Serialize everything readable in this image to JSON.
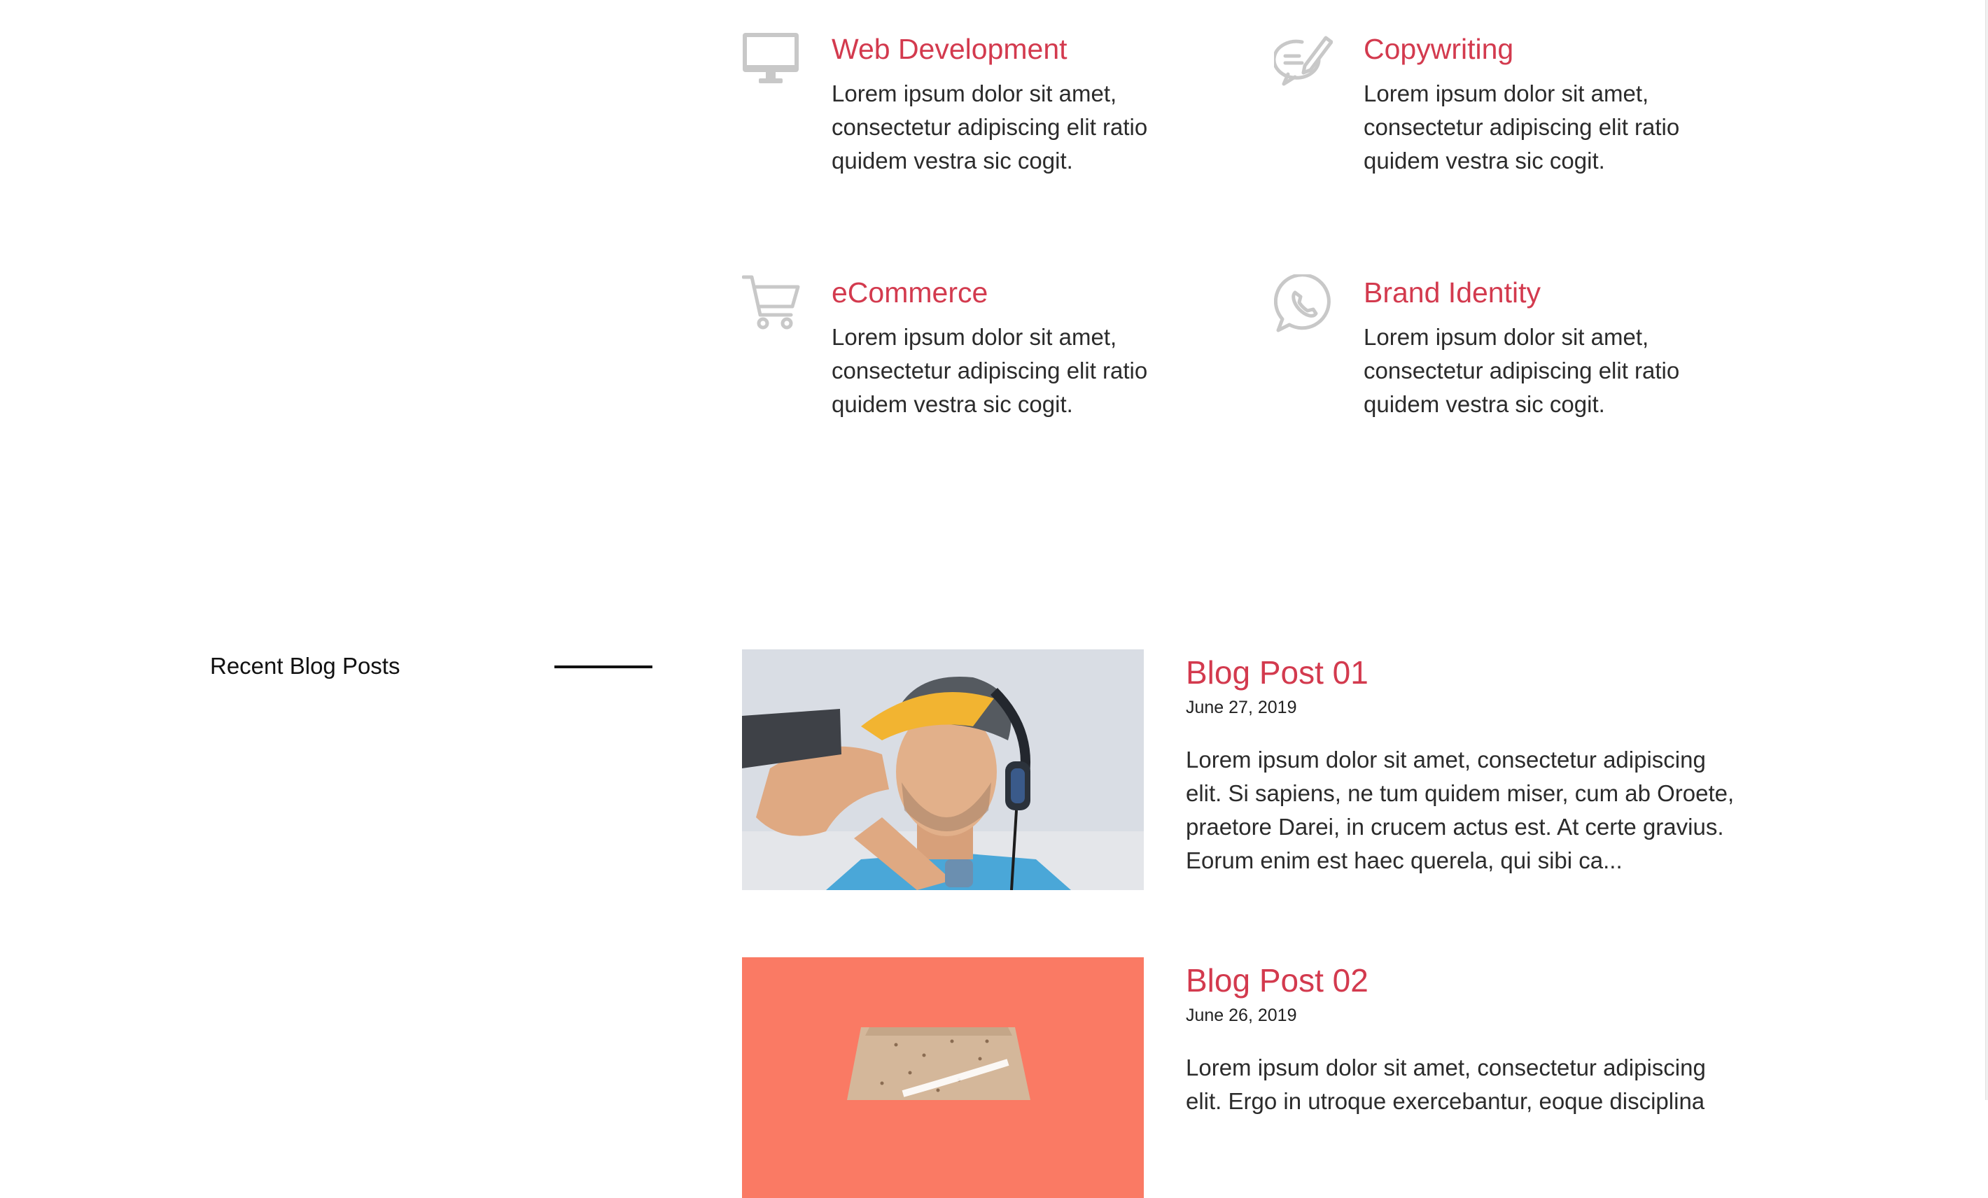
{
  "services": [
    {
      "title": "Web Development",
      "description": "Lorem ipsum dolor sit amet,\nconsectetur adipiscing elit ratio\nquidem vestra sic cogit.",
      "icon": "desktop-monitor-icon"
    },
    {
      "title": "Copywriting",
      "description": "Lorem ipsum dolor sit amet,\nconsectetur adipiscing elit ratio\nquidem vestra sic cogit.",
      "icon": "pen-writing-icon"
    },
    {
      "title": "eCommerce",
      "description": "Lorem ipsum dolor sit amet,\nconsectetur adipiscing elit ratio\nquidem vestra sic cogit.",
      "icon": "shopping-cart-icon"
    },
    {
      "title": "Brand Identity",
      "description": "Lorem ipsum dolor sit amet,\nconsectetur adipiscing elit ratio\nquidem vestra sic cogit.",
      "icon": "phone-chat-icon"
    }
  ],
  "blog": {
    "heading": "Recent Blog Posts",
    "posts": [
      {
        "title": "Blog Post 01",
        "date": "June 27, 2019",
        "excerpt": "Lorem ipsum dolor sit amet, consectetur adipiscing\nelit. Si sapiens, ne tum quidem miser, cum ab Oroete,\npraetore Darei, in crucem actus est. At certe gravius.\nEorum enim est haec querela, qui sibi ca...",
        "image": "man-with-headphones-photo"
      },
      {
        "title": "Blog Post 02",
        "date": "June 26, 2019",
        "excerpt": "Lorem ipsum dolor sit amet, consectetur adipiscing\nelit. Ergo in utroque exercebantur, eoque disciplina",
        "image": "treats-box-photo"
      }
    ]
  },
  "colors": {
    "accent": "#d33a4e",
    "text": "#2b2b2b",
    "icon_gray": "#c8c8c8",
    "post2_background": "#fa7a64"
  }
}
